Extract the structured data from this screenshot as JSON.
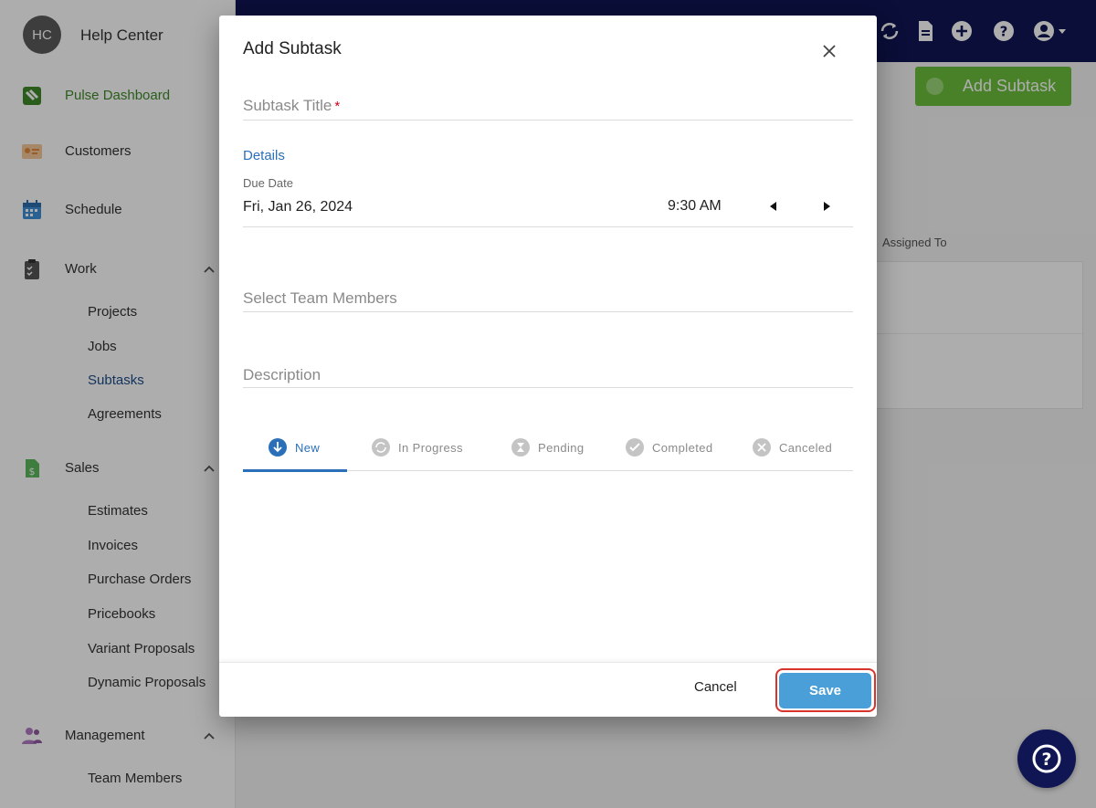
{
  "sidebar": {
    "avatar_initials": "HC",
    "brand": "Help Center",
    "items": [
      {
        "label": "Pulse Dashboard"
      },
      {
        "label": "Customers"
      },
      {
        "label": "Schedule"
      },
      {
        "label": "Work",
        "children": [
          "Projects",
          "Jobs",
          "Subtasks",
          "Agreements"
        ]
      },
      {
        "label": "Sales",
        "children": [
          "Estimates",
          "Invoices",
          "Purchase Orders",
          "Pricebooks",
          "Variant Proposals",
          "Dynamic Proposals"
        ]
      },
      {
        "label": "Management",
        "children": [
          "Team Members"
        ]
      }
    ],
    "active_child": "Subtasks"
  },
  "topbar": {
    "icons": [
      "sync-icon",
      "document-icon",
      "add-circle-icon",
      "help-icon",
      "account-icon"
    ]
  },
  "page": {
    "add_button": "Add Subtask",
    "column_assigned_to": "Assigned To"
  },
  "modal": {
    "title": "Add Subtask",
    "title_field_placeholder": "Subtask Title",
    "required_mark": "*",
    "details_label": "Details",
    "due_date_label": "Due Date",
    "due_date": "Fri, Jan 26, 2024",
    "due_time": "9:30 AM",
    "team_placeholder": "Select Team Members",
    "description_placeholder": "Description",
    "status_tabs": [
      {
        "label": "New",
        "icon": "arrow-down-circle-icon",
        "active": true
      },
      {
        "label": "In Progress",
        "icon": "sync-circle-icon",
        "active": false
      },
      {
        "label": "Pending",
        "icon": "hourglass-circle-icon",
        "active": false
      },
      {
        "label": "Completed",
        "icon": "check-circle-icon",
        "active": false
      },
      {
        "label": "Canceled",
        "icon": "x-circle-icon",
        "active": false
      }
    ],
    "cancel_label": "Cancel",
    "save_label": "Save"
  },
  "colors": {
    "navy": "#0f1653",
    "accent_blue": "#2a6fb8",
    "save_blue": "#4a9fd8",
    "green": "#6cbf3c",
    "highlight_red": "#d9332e"
  }
}
